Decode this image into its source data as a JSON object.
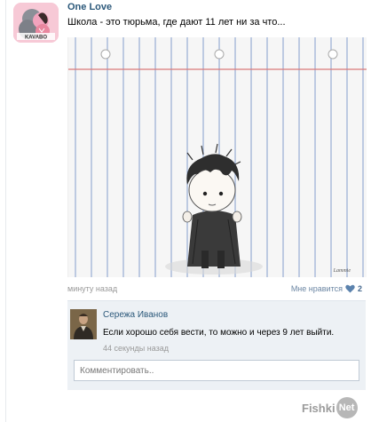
{
  "post": {
    "author": "One Love",
    "avatar_label": "KAVABO",
    "text": "Школа - это тюрьма, где дают 11 лет ни за что...",
    "image_signature": "Lammie",
    "time": "минуту назад",
    "like_label": "Мне нравится",
    "like_count": "2"
  },
  "comment": {
    "author": "Сережа Иванов",
    "text": "Если хорошо себя вести, то можно и через 9 лет выйти.",
    "time": "44 секунды назад"
  },
  "reply": {
    "placeholder": "Комментировать.."
  },
  "brand": {
    "part1": "Fishki",
    "part2": "Net"
  },
  "colors": {
    "link": "#2b587a",
    "heart": "#5b82ad",
    "comment_bg": "#edf1f5"
  }
}
